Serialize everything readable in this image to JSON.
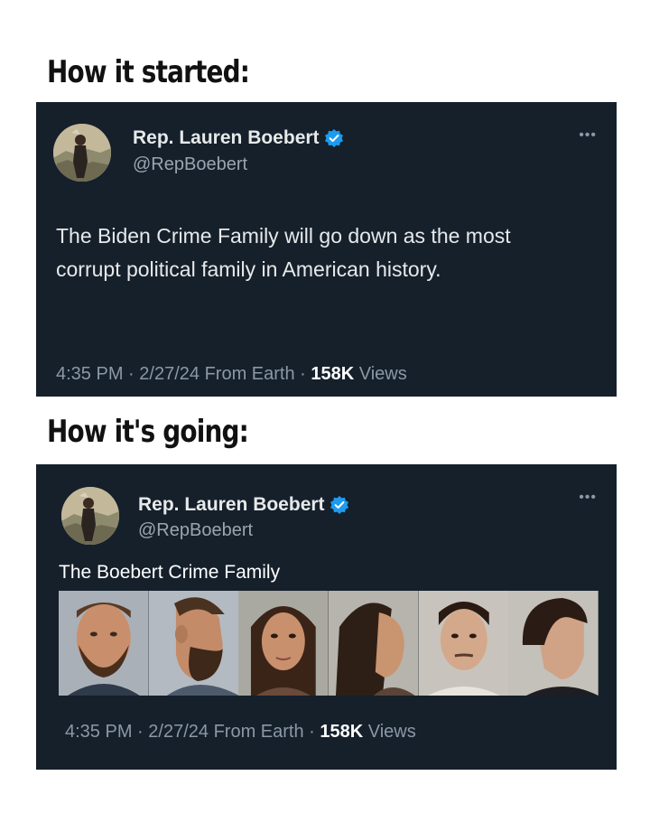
{
  "captions": {
    "started": "How it started:",
    "going": "How it's going:"
  },
  "tweet1": {
    "display_name": "Rep. Lauren Boebert",
    "handle": "@RepBoebert",
    "text": "The Biden Crime Family will go down as the most corrupt political family in American history.",
    "time": "4:35 PM",
    "date": "2/27/24",
    "source": "From Earth",
    "views_count": "158K",
    "views_label": "Views"
  },
  "tweet2": {
    "display_name": "Rep. Lauren Boebert",
    "handle": "@RepBoebert",
    "text": "The Boebert Crime Family",
    "time": "4:35 PM",
    "date": "2/27/24",
    "source": "From Earth",
    "views_count": "158K",
    "views_label": "Views",
    "photos": [
      "mugshot-front",
      "mugshot-profile",
      "mugshot-front",
      "mugshot-profile",
      "mugshot-front",
      "mugshot-profile"
    ]
  },
  "colors": {
    "tweet_bg": "#15202b",
    "text": "#e7e9ea",
    "muted": "#8b98a5",
    "verified": "#1d9bf0"
  },
  "icons": {
    "verified": "verified-badge-icon",
    "more": "more-options-icon"
  }
}
